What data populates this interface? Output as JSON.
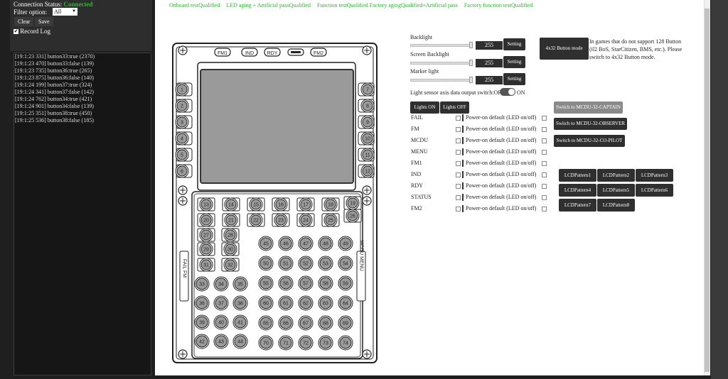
{
  "sidebar": {
    "conn_label": "Connection Status:",
    "conn_value": "Connected",
    "filter_label": "Filter option:",
    "filter_value": "All",
    "clear": "Clear",
    "save": "Save",
    "record_log": "Record Log",
    "log": [
      "[19:1:23 331] button33:true (2370)",
      "[19:1:23 470] button33:false (139)",
      "[19:1:23 735] button36:true (265)",
      "[19:1:23 875] button36:false (140)",
      "[19:1:24 199] button37:true (324)",
      "[19:1:24 341] button37:false (142)",
      "[19:1:24 762] button34:true (421)",
      "[19:1:24 901] button34:false (139)",
      "[19:1:25 351] button38:true (450)",
      "[19:1:25 536] button38:false (185)"
    ]
  },
  "status": [
    "Onboard testQualified",
    "LED aging + Artificial passQualified",
    "Function testQualified Factory agingQualified+Artificial pass",
    "Factory function testQualified"
  ],
  "panel": {
    "top_labels": [
      "FM1",
      "IND",
      "RDY",
      "FM2"
    ],
    "side_left_text": "FAIL FM",
    "side_right_text": "MCDU MENU",
    "left_buttons": [
      "1",
      "2",
      "3",
      "4",
      "5",
      "6"
    ],
    "right_buttons": [
      "7",
      "8",
      "9",
      "10",
      "11",
      "12"
    ],
    "row_buttons": [
      "13",
      "14",
      "15",
      "16",
      "17",
      "18",
      "19",
      "20",
      "21",
      "22",
      "23",
      "24",
      "25",
      "26",
      "27",
      "28",
      "29",
      "30",
      "31",
      "32"
    ],
    "grid_a": [
      "33",
      "34",
      "35",
      "36",
      "37",
      "38",
      "39",
      "40",
      "41",
      "42",
      "43",
      "44"
    ],
    "grid_b": [
      "45",
      "46",
      "47",
      "48",
      "49",
      "50",
      "51",
      "52",
      "53",
      "54",
      "55",
      "56",
      "57",
      "58",
      "59",
      "60",
      "61",
      "62",
      "63",
      "64",
      "65",
      "66",
      "67",
      "68",
      "69",
      "70",
      "71",
      "72",
      "73",
      "74"
    ]
  },
  "settings": {
    "backlight": "Backlight",
    "screen_backlight": "Screen Backlight",
    "marker_light": "Marker light",
    "backlight_val": "255",
    "screen_val": "255",
    "marker_val": "255",
    "setting": "Setting",
    "btn_mode": "4x32 Button mode",
    "mode_note": "In games that do not support 128 Button (il2 BoS, StarCitizen, BMS, etc.). Please switch to 4x32 Button mode.",
    "sensor_label": "Light sensor axis data output switch:OFF",
    "sensor_on": "ON",
    "lights_on": "Lights ON",
    "lights_off": "Lights OFF",
    "switch_captain": "Switch to MCDU-32-CAPTAIN",
    "switch_observer": "Switch to MCDU-32-OBSERVER",
    "switch_copilot": "Switch to MCDU-32-CO-PILOT",
    "leds": [
      "FAIL",
      "FM",
      "MCDU",
      "MENU",
      "FM1",
      "IND",
      "RDY",
      "STATUS",
      "FM2"
    ],
    "power_default": "Power-on default (LED on/off)",
    "patterns": [
      "LCDPattern1",
      "LCDPattern2",
      "LCDPattern3",
      "LCDPattern4",
      "LCDPattern5",
      "LCDPattern6",
      "LCDPattern7",
      "LCDPattern8"
    ]
  },
  "colors": {
    "connected": "#2db52d",
    "status_text": "#2db52d"
  }
}
